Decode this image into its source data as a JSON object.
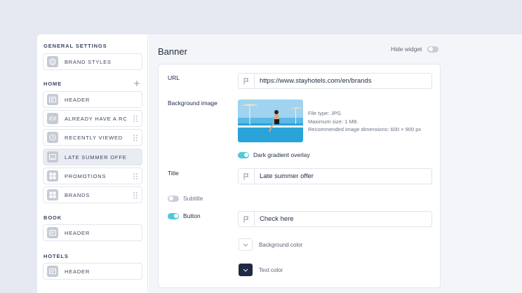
{
  "sidebar": {
    "sections": {
      "general": {
        "title": "GENERAL SETTINGS",
        "items": [
          {
            "label": "BRAND STYLES",
            "icon": "palette-icon"
          }
        ]
      },
      "home": {
        "title": "HOME",
        "items": [
          {
            "label": "HEADER",
            "icon": "header-icon"
          },
          {
            "label": "ALREADY HAVE A ROOM",
            "icon": "link-icon"
          },
          {
            "label": "RECENTLY VIEWED",
            "icon": "clock-icon"
          },
          {
            "label": "LATE SUMMER OFFER",
            "icon": "banner-icon",
            "active": true
          },
          {
            "label": "PROMOTIONS",
            "icon": "grid-icon"
          },
          {
            "label": "BRANDS",
            "icon": "grid-icon"
          }
        ]
      },
      "book": {
        "title": "BOOK",
        "items": [
          {
            "label": "HEADER",
            "icon": "header-icon"
          }
        ]
      },
      "hotels": {
        "title": "HOTELS",
        "items": [
          {
            "label": "HEADER",
            "icon": "header-icon"
          }
        ]
      }
    }
  },
  "main": {
    "title": "Banner",
    "hide_widget_label": "Hide widget",
    "hide_widget_on": false,
    "form": {
      "url": {
        "label": "URL",
        "value": "https://www.stayhotels.com/en/brands"
      },
      "background_image": {
        "label": "Background image",
        "info": [
          "File type: JPG",
          "Maximum size: 1 MB.",
          "Recommended image dimensions: 600 × 900 px"
        ]
      },
      "dark_gradient": {
        "label": "Dark gradient overlay",
        "on": true
      },
      "title": {
        "label": "Title",
        "value": "Late summer offer"
      },
      "subtitle": {
        "label": "Subtitle",
        "on": false
      },
      "button": {
        "label": "Button",
        "on": true,
        "value": "Check here"
      },
      "background_color": {
        "label": "Background color"
      },
      "text_color": {
        "label": "Text color"
      }
    }
  },
  "colors": {
    "accent": "#4fc8d8",
    "dark": "#1f2a44",
    "icon_bg": "#c5cad4",
    "active_bg": "#e9ecf2"
  }
}
